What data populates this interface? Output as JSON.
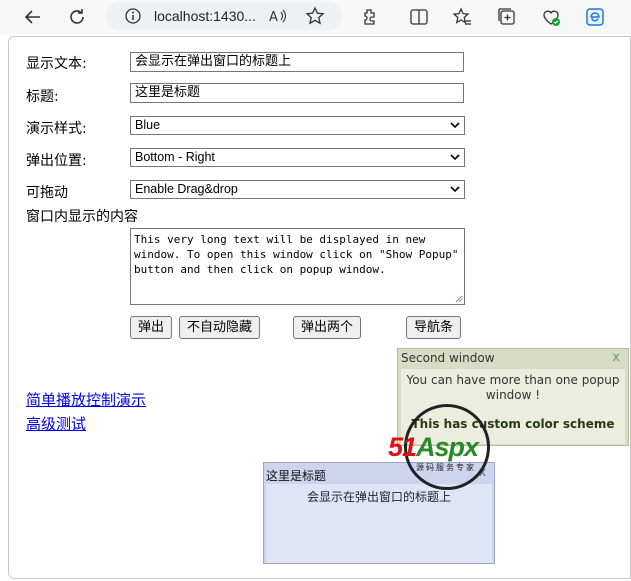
{
  "browser": {
    "url": "localhost:1430...",
    "icons": [
      "back-icon",
      "refresh-icon",
      "info-icon",
      "read-aloud-icon",
      "favorite-icon",
      "extensions-icon",
      "split-screen-icon",
      "favorites-icon",
      "collections-icon",
      "browser-essentials-icon",
      "edge-icon"
    ]
  },
  "form": {
    "display_text_label": "显示文本:",
    "display_text_value": "会显示在弹出窗口的标题上",
    "title_label": "标题:",
    "title_value": "这里是标题",
    "style_label": "演示样式:",
    "style_value": "Blue",
    "position_label": "弹出位置:",
    "position_value": "Bottom - Right",
    "drag_label": "可拖动",
    "drag_value": "Enable Drag&drop",
    "content_label": "窗口内显示的内容",
    "content_value": "This very long text will be displayed in new window. To open this window click on \"Show Popup\" button and then click on popup window."
  },
  "buttons": {
    "popup": "弹出",
    "no_autohide": "不自动隐藏",
    "popup_two": "弹出两个",
    "navbar": "导航条"
  },
  "links": {
    "simple_playback": "简单播放控制演示",
    "advanced_test": "高级测试"
  },
  "popup2": {
    "title": "Second window",
    "close": "x",
    "message": "You can have more than one popup window !",
    "custom": "This has custom color scheme"
  },
  "popup1": {
    "title": "这里是标题",
    "close": "x",
    "message": "会显示在弹出窗口的标题上"
  },
  "watermark": {
    "brand_num": "51",
    "brand_text": "Aspx",
    "sub": "源码服务专家"
  },
  "colors": {
    "link": "#0000ee",
    "popup1_bg": "#dfe5f7",
    "popup2_bg": "#ebeddf"
  }
}
